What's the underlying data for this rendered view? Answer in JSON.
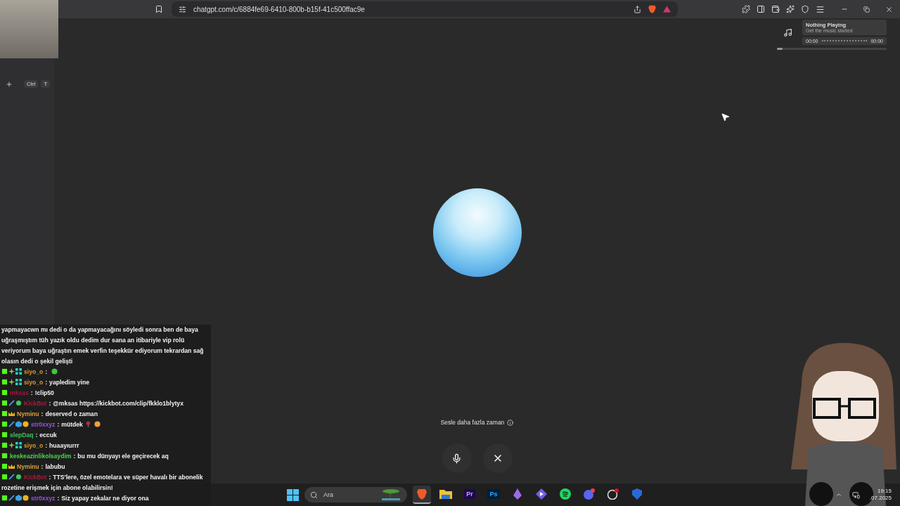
{
  "browser": {
    "url": "chatgpt.com/c/6884fe69-6410-800b-b15f-41c500ffac9e",
    "new_tab_keys": [
      "Ctrl",
      "T"
    ]
  },
  "music_widget": {
    "title": "Nothing Playing",
    "subtitle": "Get the music started",
    "elapsed": "00:00",
    "total": "00:00",
    "level": 0.05
  },
  "voice": {
    "hint": "Sesle daha fazla zaman"
  },
  "chat": [
    {
      "kind": "continuation",
      "text": "yapmayacwn mı dedi o da yapmayacağını söyledi sonra ben de baya uğraşmıştım tüh yazık oldu dedim dur sana an itibariyle vip rolü veriyorum baya uğraştın emek verfin teşekkür ediyorum tekrardan sağ olasın dedi o şekil gelişti"
    },
    {
      "kind": "message",
      "badges": [
        {
          "kind": "kick"
        },
        {
          "kind": "sparkle"
        },
        {
          "kind": "grid"
        }
      ],
      "user": "siyo_o",
      "color": "#d89a2a",
      "separator": ":",
      "emotes": [
        {
          "kind": "green"
        }
      ]
    },
    {
      "kind": "message",
      "badges": [
        {
          "kind": "kick"
        },
        {
          "kind": "sparkle"
        },
        {
          "kind": "grid"
        }
      ],
      "user": "siyo_o",
      "color": "#d89a2a",
      "separator": ":",
      "text": "yapledim yine"
    },
    {
      "kind": "message",
      "badges": [
        {
          "kind": "kick"
        }
      ],
      "user": "mksas",
      "color": "#a0183a",
      "separator": ":",
      "text": "!clip50"
    },
    {
      "kind": "message",
      "badges": [
        {
          "kind": "kick"
        },
        {
          "kind": "sword"
        },
        {
          "kind": "check"
        }
      ],
      "user": "KickBot",
      "color": "#b01838",
      "separator": ":",
      "text": "@mksas https://kickbot.com/clip/fkklo1blytyx"
    },
    {
      "kind": "message",
      "badges": [
        {
          "kind": "kick"
        },
        {
          "kind": "crown"
        }
      ],
      "user": "Nyminu",
      "color": "#e0a030",
      "separator": ":",
      "text": "deserved o zaman"
    },
    {
      "kind": "message",
      "badges": [
        {
          "kind": "kick"
        },
        {
          "kind": "sword"
        },
        {
          "kind": "cube"
        },
        {
          "kind": "coin"
        }
      ],
      "user": "str0xxyz",
      "color": "#9a50e0",
      "separator": ":",
      "text": "mütdek",
      "emotes": [
        {
          "kind": "rose"
        },
        {
          "kind": "face"
        }
      ]
    },
    {
      "kind": "message",
      "badges": [
        {
          "kind": "kick"
        }
      ],
      "user": "slepDaq",
      "color": "#3cc85a",
      "separator": ":",
      "text": "eccuk"
    },
    {
      "kind": "message",
      "badges": [
        {
          "kind": "kick"
        },
        {
          "kind": "sparkle"
        },
        {
          "kind": "grid"
        }
      ],
      "user": "siyo_o",
      "color": "#d89a2a",
      "separator": ":",
      "text": "huaayıurrr"
    },
    {
      "kind": "message",
      "badges": [
        {
          "kind": "kick"
        }
      ],
      "user": "keskeazinlikolsaydim",
      "color": "#48d848",
      "separator": ":",
      "text": "bu mu dünyayı ele geçirecek aq"
    },
    {
      "kind": "message",
      "badges": [
        {
          "kind": "kick"
        },
        {
          "kind": "crown"
        }
      ],
      "user": "Nyminu",
      "color": "#e0a030",
      "separator": ":",
      "text": "labubu"
    },
    {
      "kind": "message",
      "badges": [
        {
          "kind": "kick"
        },
        {
          "kind": "sword"
        },
        {
          "kind": "check"
        }
      ],
      "user": "KickBot",
      "color": "#b01838",
      "separator": ":",
      "text": "TTS'lere, özel emotelara ve süper havalı bir abonelik",
      "text_wrapped": "rozetine erişmek için abone olabilirsin!"
    },
    {
      "kind": "message",
      "badges": [
        {
          "kind": "kick"
        },
        {
          "kind": "sword"
        },
        {
          "kind": "cube"
        },
        {
          "kind": "coin"
        }
      ],
      "user": "str0xxyz",
      "color": "#9a50e0",
      "separator": ":",
      "text": "Siz yapay zekalar ne diyor ona"
    }
  ],
  "taskbar": {
    "search_placeholder": "Ara",
    "apps": [
      {
        "kind": "brave",
        "selected": true
      },
      {
        "kind": "folder",
        "selected": false
      },
      {
        "kind": "premiere",
        "label": "Pr",
        "selected": false
      },
      {
        "kind": "photoshop",
        "label": "Ps",
        "selected": false
      },
      {
        "kind": "crystal",
        "selected": false
      },
      {
        "kind": "play",
        "selected": false
      },
      {
        "kind": "spotify",
        "selected": false
      },
      {
        "kind": "discord",
        "selected": false
      },
      {
        "kind": "obs",
        "selected": false
      },
      {
        "kind": "vpn",
        "selected": false
      }
    ],
    "time": "19:15",
    "date": ".07.2025"
  }
}
